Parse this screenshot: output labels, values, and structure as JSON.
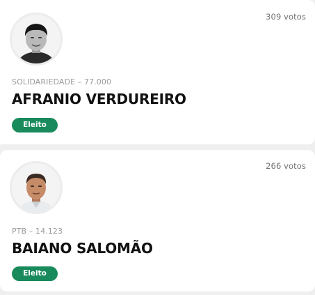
{
  "candidates": [
    {
      "votes": "309 votos",
      "party": "SOLIDARIEDADE – 77.000",
      "name": "AFRANIO VERDUREIRO",
      "status": "Eleito"
    },
    {
      "votes": "266 votos",
      "party": "PTB – 14.123",
      "name": "BAIANO SALOMÃO",
      "status": "Eleito"
    }
  ],
  "colors": {
    "badge": "#198a5c",
    "background": "#efefef",
    "card": "#ffffff"
  }
}
